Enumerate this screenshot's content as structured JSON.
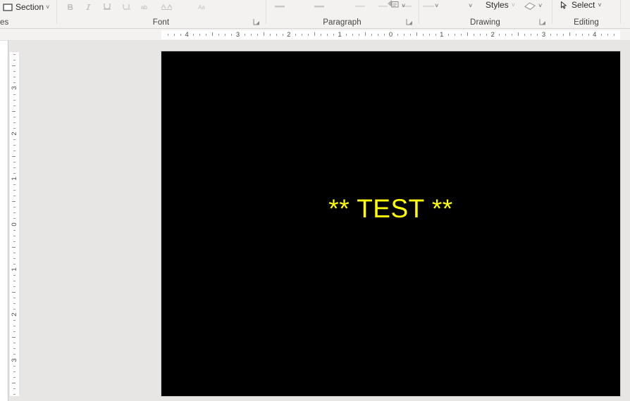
{
  "ribbon": {
    "groups": [
      {
        "name": "slides",
        "label": "es",
        "section_button": {
          "label": "Section",
          "caret": "˅",
          "icon": "section-icon"
        }
      },
      {
        "name": "font",
        "label": "Font",
        "buttons": [
          {
            "icon": "bold-icon",
            "label": "B"
          },
          {
            "icon": "italic-icon",
            "label": "I"
          },
          {
            "icon": "underline-icon",
            "label": "U"
          },
          {
            "icon": "text-shadow-icon",
            "label": "S"
          },
          {
            "icon": "strikethrough-icon",
            "label": "ab"
          },
          {
            "icon": "character-spacing-icon",
            "label": "AV"
          },
          {
            "icon": "change-case-icon",
            "label": "Aa"
          }
        ]
      },
      {
        "name": "paragraph",
        "label": "Paragraph",
        "buttons": [
          {
            "icon": "bullets-icon"
          },
          {
            "icon": "numbering-icon"
          },
          {
            "icon": "align-left-icon"
          },
          {
            "icon": "align-center-icon"
          },
          {
            "icon": "align-right-icon"
          },
          {
            "icon": "justify-icon"
          },
          {
            "icon": "convert-to-smartart-icon",
            "caret": "˅"
          }
        ]
      },
      {
        "name": "drawing",
        "label": "Drawing",
        "shapes_caret": "˅",
        "arrange_caret": "˅",
        "styles_label": "Styles",
        "styles_caret": "˅",
        "shape_fill_icon": "shape-fill-icon",
        "shape_fill_caret": "˅"
      },
      {
        "name": "editing",
        "label": "Editing",
        "select_label": "Select",
        "select_caret": "˅",
        "select_icon": "select-cursor-icon"
      }
    ]
  },
  "rulers": {
    "horizontal": {
      "labels": [
        "4",
        "3",
        "2",
        "1",
        "0",
        "1",
        "2",
        "3",
        "4"
      ]
    },
    "vertical": {
      "labels": [
        "3",
        "2",
        "1",
        "0",
        "1",
        "2",
        "3"
      ]
    }
  },
  "slide": {
    "background_color": "#000000",
    "title_text": "** TEST **",
    "title_color": "#FFFF00"
  }
}
